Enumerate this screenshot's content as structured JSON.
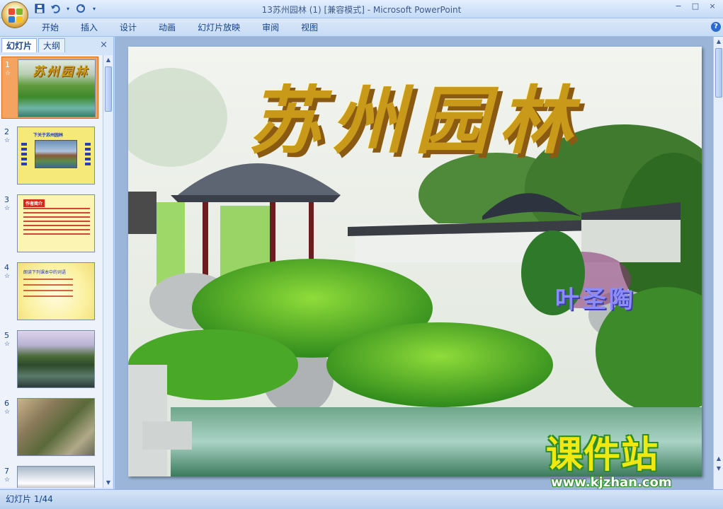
{
  "window": {
    "title": "13苏州园林 (1) [兼容模式] - Microsoft PowerPoint",
    "controls": [
      "−",
      "□",
      "×"
    ]
  },
  "quick_access": {
    "save_icon": "save-icon",
    "undo_icon": "undo-icon",
    "redo_icon": "redo-icon"
  },
  "ribbon": {
    "tabs": [
      "开始",
      "插入",
      "设计",
      "动画",
      "幻灯片放映",
      "审阅",
      "视图"
    ],
    "help": "?"
  },
  "pane": {
    "tabs": [
      "幻灯片",
      "大纲"
    ],
    "close": "×",
    "thumbnails": [
      {
        "num": "1",
        "star": "☆",
        "title": "苏州园林"
      },
      {
        "num": "2",
        "star": "☆",
        "title": "下关于苏州园林"
      },
      {
        "num": "3",
        "star": "☆",
        "title": "作者简介"
      },
      {
        "num": "4",
        "star": "☆",
        "title": "朗读下列课本中的词语"
      },
      {
        "num": "5",
        "star": "☆",
        "title": ""
      },
      {
        "num": "6",
        "star": "☆",
        "title": ""
      },
      {
        "num": "7",
        "star": "☆",
        "title": ""
      }
    ]
  },
  "slide": {
    "title": "苏州园林",
    "author": "叶圣陶"
  },
  "watermark": {
    "main": "课件站",
    "url": "www.kjzhan.com"
  },
  "status": {
    "slide_counter": "幻灯片 1/44"
  },
  "colors": {
    "selected_thumb": "#f4a460",
    "title_gold": "#c99a1a",
    "author_purple": "#8b8cff",
    "watermark_yellow": "#f1e812",
    "watermark_green": "#2b8d23"
  }
}
